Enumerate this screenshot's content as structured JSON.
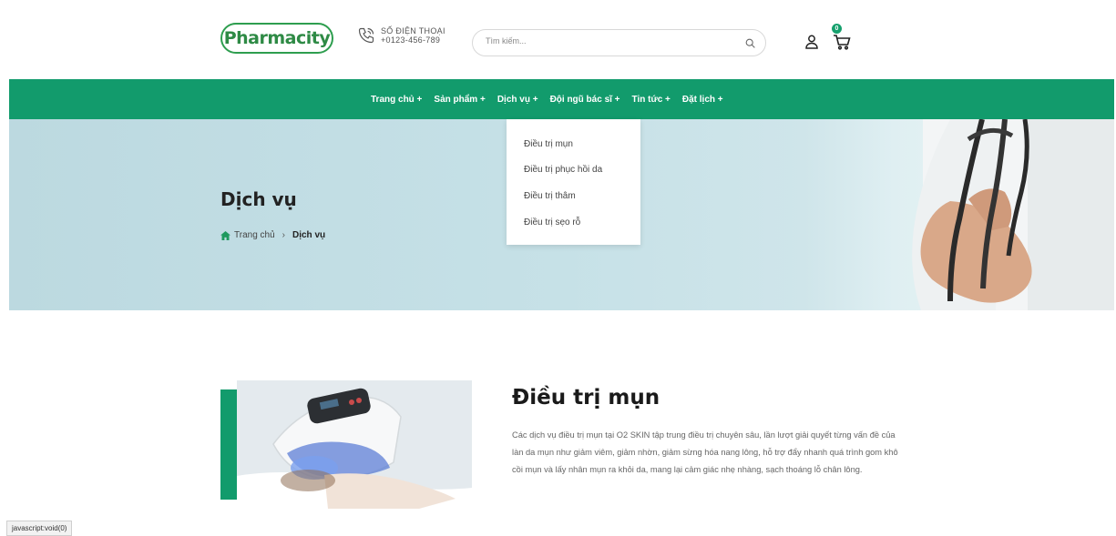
{
  "header": {
    "logo": {
      "part1": "Pharma",
      "part2": "city"
    },
    "phone": {
      "label": "SỐ ĐIỆN THOẠI",
      "number": "+0123-456-789"
    },
    "search": {
      "placeholder": "Tìm kiếm..."
    },
    "cart": {
      "count": "0"
    }
  },
  "nav": {
    "items": [
      {
        "label": "Trang chủ +"
      },
      {
        "label": "Sản phẩm +"
      },
      {
        "label": "Dịch vụ +"
      },
      {
        "label": "Đội ngũ bác sĩ +"
      },
      {
        "label": "Tin tức +"
      },
      {
        "label": "Đặt lịch +"
      }
    ]
  },
  "dropdown": {
    "items": [
      {
        "label": "Điều trị mụn"
      },
      {
        "label": "Điều trị phục hồi da"
      },
      {
        "label": "Điều trị thâm"
      },
      {
        "label": "Điều trị sẹo rỗ"
      }
    ]
  },
  "banner": {
    "title": "Dịch vụ",
    "breadcrumb": {
      "home": "Trang chủ",
      "separator": "›",
      "current": "Dịch vụ"
    }
  },
  "section": {
    "title": "Điều trị mụn",
    "description": "Các dịch vụ điều trị mụn tại O2 SKIN tập trung điều trị chuyên sâu, lần lượt giải quyết từng vấn đề của làn da mụn như giảm viêm, giảm nhờn, giảm sừng hóa nang lông, hỗ trợ đẩy nhanh quá trình gom khô cồi mụn và lấy nhân mụn ra khỏi da, mang lại cảm giác nhẹ nhàng, sạch thoáng lỗ chân lông."
  },
  "statusbar": {
    "text": "javascript:void(0)"
  },
  "colors": {
    "brand_green": "#129b6c",
    "logo_green": "#2e8a45"
  }
}
